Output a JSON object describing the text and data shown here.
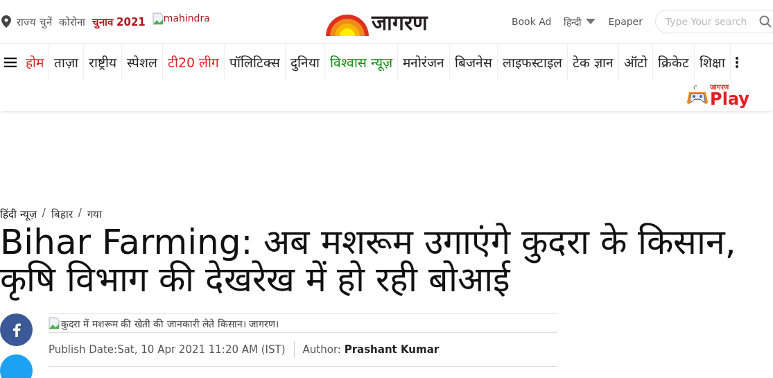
{
  "top_bar": {
    "state_picker": "राज्य चुनें",
    "links": [
      {
        "label": "कोरोना",
        "color": "#555555"
      },
      {
        "label": "चुनाव 2021",
        "color": "#b5121b"
      }
    ],
    "sponsor_image_alt": "mahindra",
    "logo": "जागरण",
    "book_ad": "Book Ad",
    "language": "हिन्दी",
    "epaper": "Epaper",
    "search": {
      "placeholder": "Type Your search"
    }
  },
  "nav": {
    "items": [
      {
        "label": "होम",
        "color": "#e31e24"
      },
      {
        "label": "ताज़ा",
        "color": "#222222"
      },
      {
        "label": "राष्ट्रीय",
        "color": "#222222"
      },
      {
        "label": "स्पेशल",
        "color": "#222222"
      },
      {
        "label": "टी20 लीग",
        "color": "#e31e24"
      },
      {
        "label": "पॉलिटिक्स",
        "color": "#222222"
      },
      {
        "label": "दुनिया",
        "color": "#222222"
      },
      {
        "label": "विश्वास न्यूज़",
        "color": "#0a8a0a"
      },
      {
        "label": "मनोरंजन",
        "color": "#222222"
      },
      {
        "label": "बिजनेस",
        "color": "#222222"
      },
      {
        "label": "लाइफस्टाइल",
        "color": "#222222"
      },
      {
        "label": "टेक ज्ञान",
        "color": "#222222"
      },
      {
        "label": "ऑटो",
        "color": "#222222"
      },
      {
        "label": "क्रिकेट",
        "color": "#222222"
      },
      {
        "label": "शिक्षा",
        "color": "#222222"
      }
    ]
  },
  "play_logo": {
    "brand": "जागरण",
    "label": "Play"
  },
  "breadcrumb": {
    "separator": "/",
    "items": [
      "हिंदी न्यूज़",
      "बिहार",
      "गया"
    ]
  },
  "article": {
    "title": "Bihar Farming: अब मशरूम उगाएंगे कुदरा के किसान, कृषि विभाग की देखरेख में हो रही बोआई",
    "image_alt": "कुदरा में मशरूम की खेती की जानकारी लेते किसान। जागरण।",
    "publish_date": "Publish Date:Sat, 10 Apr 2021 11:20 AM (IST)",
    "author_label": "Author:",
    "author": "Prashant Kumar"
  }
}
